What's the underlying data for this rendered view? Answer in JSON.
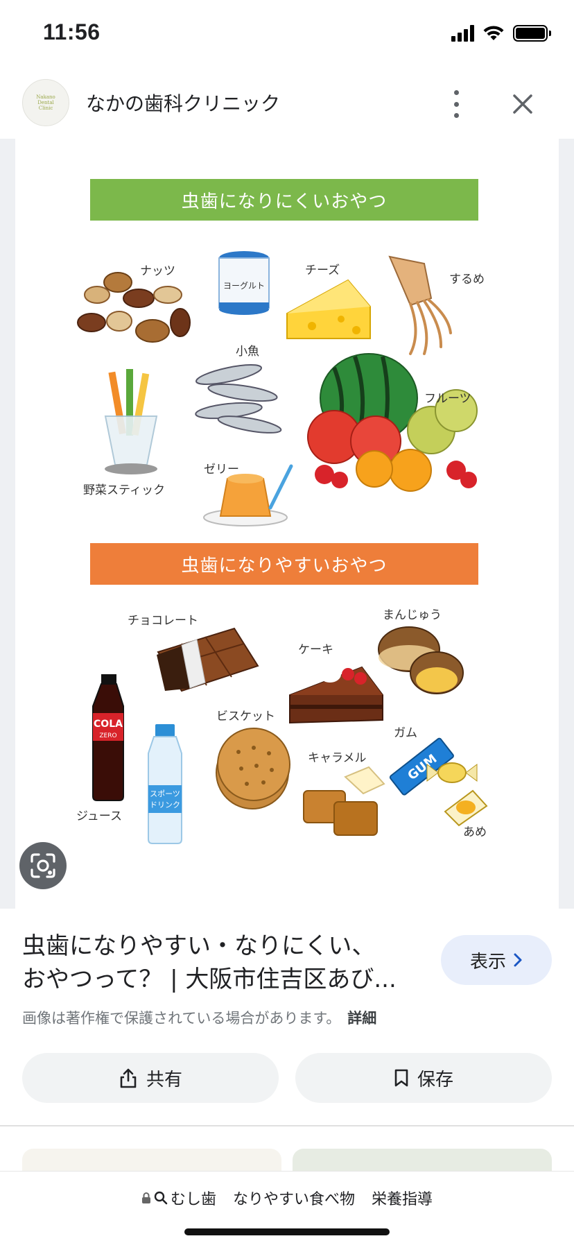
{
  "status_bar": {
    "time": "11:56"
  },
  "header": {
    "logo_lines": [
      "Nakano",
      "Dental",
      "Clinic"
    ],
    "site_name": "なかの歯科クリニック"
  },
  "image": {
    "band_good": "虫歯になりにくいおやつ",
    "band_bad": "虫歯になりやすいおやつ",
    "labels_good": {
      "nuts": "ナッツ",
      "yogurt": "ヨーグルト",
      "cheese": "チーズ",
      "squid": "するめ",
      "small_fish": "小魚",
      "fruits": "フルーツ",
      "veg_sticks": "野菜スティック",
      "jelly": "ゼリー"
    },
    "labels_bad": {
      "chocolate": "チョコレート",
      "manju": "まんじゅう",
      "cake": "ケーキ",
      "biscuit": "ビスケット",
      "gum": "ガム",
      "caramel": "キャラメル",
      "juice": "ジュース",
      "candy": "あめ"
    },
    "product_text": {
      "cola": "COLA",
      "cola_sub": "ZERO",
      "sports_drink_line1": "スポーツ",
      "sports_drink_line2": "ドリンク",
      "gum_pack": "GUM"
    },
    "colors": {
      "good": "#7cb84b",
      "bad": "#ee7e3a"
    }
  },
  "result": {
    "title_line1": "虫歯になりやすい・なりにくい、",
    "title_line2": "おやつって？ | 大阪市住吉区あび...",
    "view_label": "表示",
    "copyright": "画像は著作権で保護されている場合があります。",
    "details_label": "詳細",
    "share_label": "共有",
    "save_label": "保存"
  },
  "bottom": {
    "query_terms": [
      "むし歯",
      "なりやすい食べ物",
      "栄養指導"
    ]
  }
}
